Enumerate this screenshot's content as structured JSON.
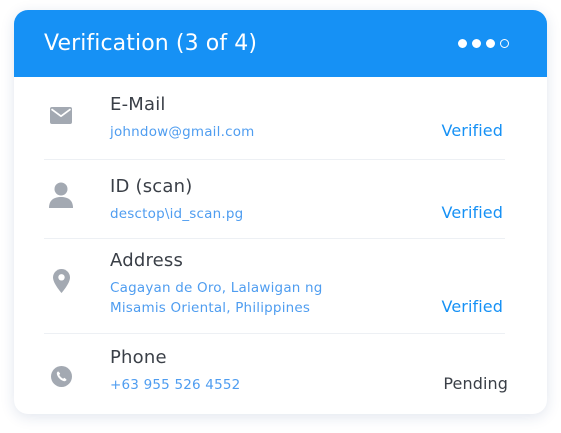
{
  "header": {
    "title": "Verification (3 of 4)",
    "steps": {
      "completed": 3,
      "total": 4
    }
  },
  "colors": {
    "accent": "#1691f5",
    "value_text": "#4f9df0",
    "label_text": "#3a3f47",
    "icon": "#a3a9b2"
  },
  "rows": [
    {
      "icon": "envelope-icon",
      "label": "E-Mail",
      "value": "johndow@gmail.com",
      "status": "Verified"
    },
    {
      "icon": "person-icon",
      "label": "ID (scan)",
      "value": "desctop\\id_scan.pg",
      "status": "Verified"
    },
    {
      "icon": "location-pin-icon",
      "label": "Address",
      "value_lines": [
        "Cagayan de Oro, Lalawigan ng",
        "Misamis Oriental, Philippines"
      ],
      "status": "Verified"
    },
    {
      "icon": "phone-icon",
      "label": "Phone",
      "value": "+63 955 526 4552",
      "status": "Pending"
    }
  ]
}
